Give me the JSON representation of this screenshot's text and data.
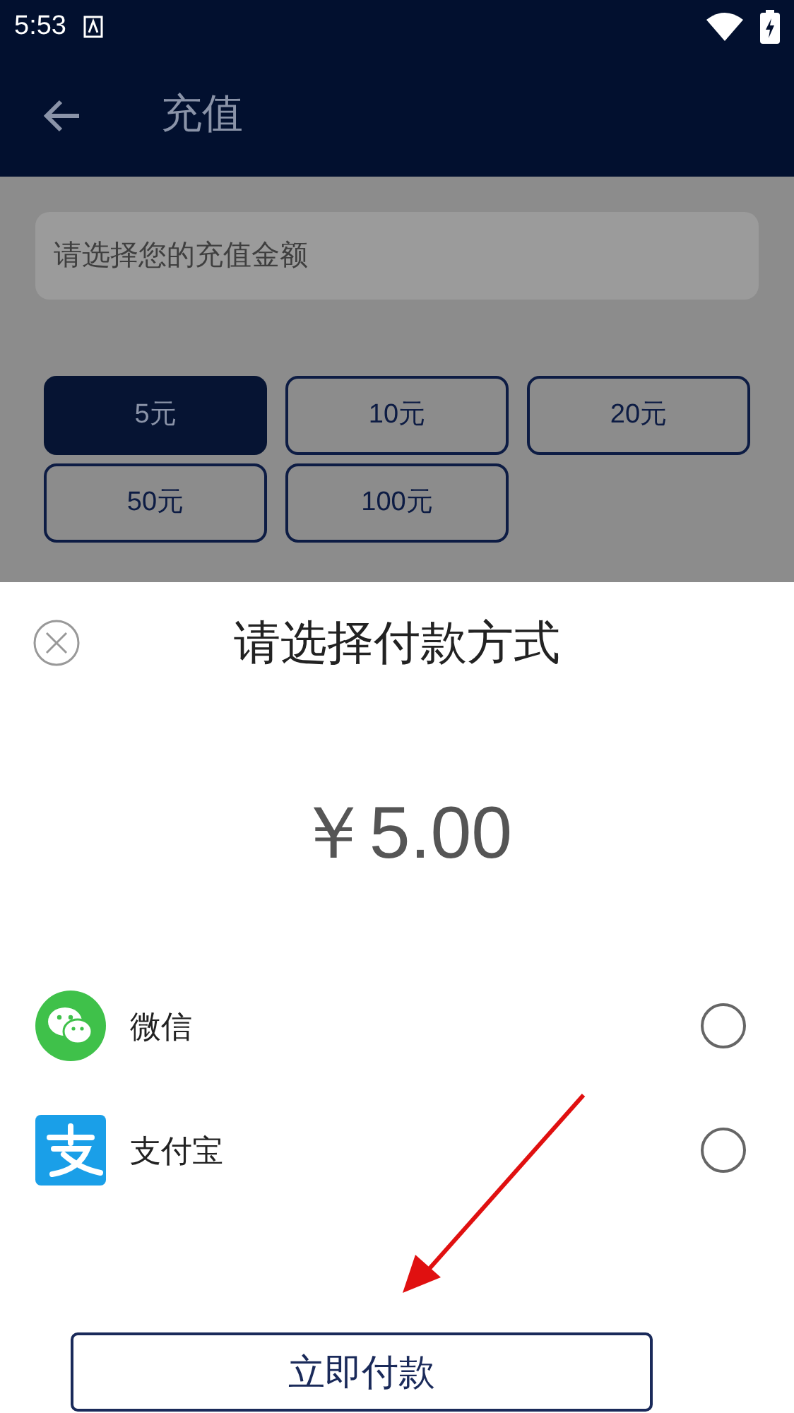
{
  "status_bar": {
    "time": "5:53"
  },
  "header": {
    "title": "充值"
  },
  "amount_field": {
    "placeholder": "请选择您的充值金额"
  },
  "amount_options": [
    {
      "label": "5元",
      "selected": true
    },
    {
      "label": "10元",
      "selected": false
    },
    {
      "label": "20元",
      "selected": false
    },
    {
      "label": "50元",
      "selected": false
    },
    {
      "label": "100元",
      "selected": false
    }
  ],
  "payment_sheet": {
    "title": "请选择付款方式",
    "amount": "￥5.00",
    "methods": [
      {
        "kind": "wechat",
        "label": "微信",
        "selected": false
      },
      {
        "kind": "alipay",
        "label": "支付宝",
        "selected": false
      }
    ],
    "pay_button": "立即付款"
  }
}
